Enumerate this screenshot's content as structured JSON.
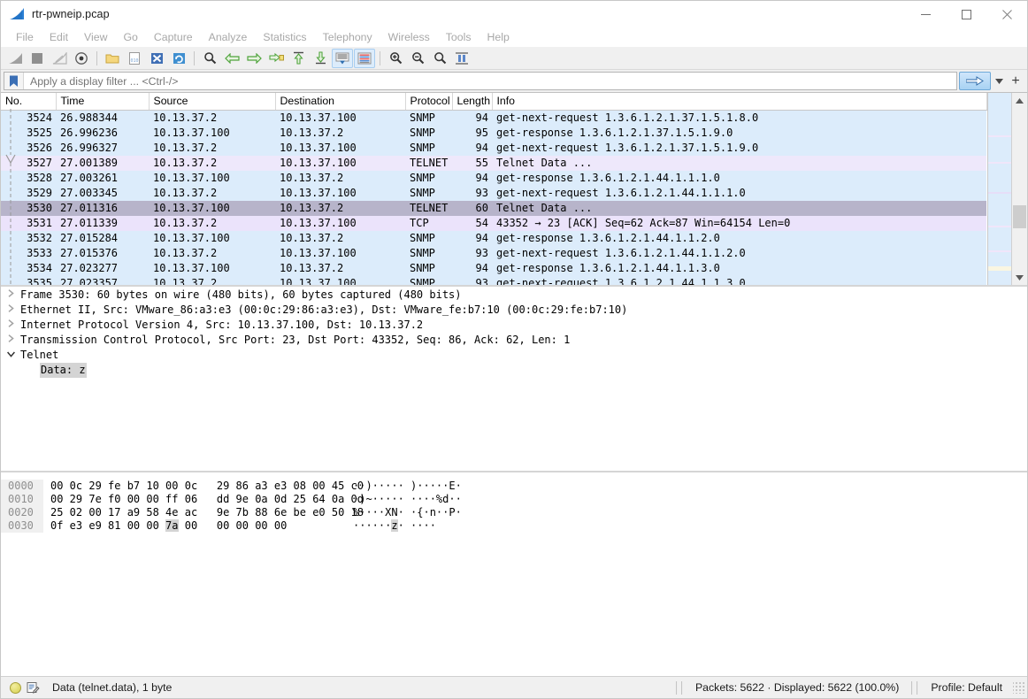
{
  "window": {
    "title": "rtr-pwneip.pcap",
    "logo_icon": "wireshark-fin-icon",
    "minimize_label": "—",
    "maximize_label": "☐",
    "close_label": "✕"
  },
  "menu": {
    "items": [
      {
        "label": "File"
      },
      {
        "label": "Edit"
      },
      {
        "label": "View"
      },
      {
        "label": "Go"
      },
      {
        "label": "Capture"
      },
      {
        "label": "Analyze"
      },
      {
        "label": "Statistics"
      },
      {
        "label": "Telephony"
      },
      {
        "label": "Wireless"
      },
      {
        "label": "Tools"
      },
      {
        "label": "Help"
      }
    ]
  },
  "toolbar": {
    "buttons": [
      {
        "name": "start-capture-icon",
        "title": "Start capturing packets"
      },
      {
        "name": "stop-capture-icon",
        "title": "Stop capturing packets"
      },
      {
        "name": "restart-capture-icon",
        "title": "Restart current capture"
      },
      {
        "name": "capture-options-icon",
        "title": "Capture options"
      },
      {
        "name": "open-file-icon",
        "title": "Open capture file"
      },
      {
        "name": "save-file-icon",
        "title": "Save this capture file"
      },
      {
        "name": "close-file-icon",
        "title": "Close this capture file"
      },
      {
        "name": "reload-file-icon",
        "title": "Reload this file"
      },
      {
        "name": "find-packet-icon",
        "title": "Find a packet"
      },
      {
        "name": "go-back-icon",
        "title": "Go back in packet history"
      },
      {
        "name": "go-forward-icon",
        "title": "Go forward in packet history"
      },
      {
        "name": "go-to-packet-icon",
        "title": "Go to the packet with number"
      },
      {
        "name": "go-first-packet-icon",
        "title": "Go to the first packet"
      },
      {
        "name": "go-last-packet-icon",
        "title": "Go to the last packet"
      },
      {
        "name": "auto-scroll-icon",
        "title": "Auto scroll in live capture"
      },
      {
        "name": "colorize-icon",
        "title": "Colorize packet list"
      },
      {
        "name": "zoom-in-icon",
        "title": "Zoom in"
      },
      {
        "name": "zoom-out-icon",
        "title": "Zoom out"
      },
      {
        "name": "zoom-reset-icon",
        "title": "Normal size"
      },
      {
        "name": "resize-columns-icon",
        "title": "Resize columns"
      }
    ]
  },
  "filter": {
    "bookmark_icon": "bookmark-icon",
    "placeholder": "Apply a display filter ... <Ctrl-/>",
    "value": "",
    "apply_icon": "arrow-right-icon",
    "dropdown_icon": "chevron-down-icon",
    "add_icon": "plus-icon"
  },
  "packet_list": {
    "columns": [
      "No.",
      "Time",
      "Source",
      "Destination",
      "Protocol",
      "Length",
      "Info"
    ],
    "rows": [
      {
        "no": "3524",
        "time": "26.988344",
        "src": "10.13.37.2",
        "dst": "10.13.37.100",
        "proto": "SNMP",
        "len": "94",
        "info": "get-next-request 1.3.6.1.2.1.37.1.5.1.8.0",
        "style": "r-snmp"
      },
      {
        "no": "3525",
        "time": "26.996236",
        "src": "10.13.37.100",
        "dst": "10.13.37.2",
        "proto": "SNMP",
        "len": "95",
        "info": "get-response 1.3.6.1.2.1.37.1.5.1.9.0",
        "style": "r-snmp"
      },
      {
        "no": "3526",
        "time": "26.996327",
        "src": "10.13.37.2",
        "dst": "10.13.37.100",
        "proto": "SNMP",
        "len": "94",
        "info": "get-next-request 1.3.6.1.2.1.37.1.5.1.9.0",
        "style": "r-snmp"
      },
      {
        "no": "3527",
        "time": "27.001389",
        "src": "10.13.37.2",
        "dst": "10.13.37.100",
        "proto": "TELNET",
        "len": "55",
        "info": "Telnet Data ...",
        "style": "r-telnet"
      },
      {
        "no": "3528",
        "time": "27.003261",
        "src": "10.13.37.100",
        "dst": "10.13.37.2",
        "proto": "SNMP",
        "len": "94",
        "info": "get-response 1.3.6.1.2.1.44.1.1.1.0",
        "style": "r-snmp"
      },
      {
        "no": "3529",
        "time": "27.003345",
        "src": "10.13.37.2",
        "dst": "10.13.37.100",
        "proto": "SNMP",
        "len": "93",
        "info": "get-next-request 1.3.6.1.2.1.44.1.1.1.0",
        "style": "r-snmp"
      },
      {
        "no": "3530",
        "time": "27.011316",
        "src": "10.13.37.100",
        "dst": "10.13.37.2",
        "proto": "TELNET",
        "len": "60",
        "info": "Telnet Data ...",
        "style": "r-sel"
      },
      {
        "no": "3531",
        "time": "27.011339",
        "src": "10.13.37.2",
        "dst": "10.13.37.100",
        "proto": "TCP",
        "len": "54",
        "info": "43352 → 23 [ACK] Seq=62 Ack=87 Win=64154 Len=0",
        "style": "r-tcp"
      },
      {
        "no": "3532",
        "time": "27.015284",
        "src": "10.13.37.100",
        "dst": "10.13.37.2",
        "proto": "SNMP",
        "len": "94",
        "info": "get-response 1.3.6.1.2.1.44.1.1.2.0",
        "style": "r-snmp"
      },
      {
        "no": "3533",
        "time": "27.015376",
        "src": "10.13.37.2",
        "dst": "10.13.37.100",
        "proto": "SNMP",
        "len": "93",
        "info": "get-next-request 1.3.6.1.2.1.44.1.1.2.0",
        "style": "r-snmp"
      },
      {
        "no": "3534",
        "time": "27.023277",
        "src": "10.13.37.100",
        "dst": "10.13.37.2",
        "proto": "SNMP",
        "len": "94",
        "info": "get-response 1.3.6.1.2.1.44.1.1.3.0",
        "style": "r-snmp"
      },
      {
        "no": "3535",
        "time": "27.023357",
        "src": "10.13.37.2",
        "dst": "10.13.37.100",
        "proto": "SNMP",
        "len": "93",
        "info": "get-next-request 1.3.6.1.2.1.44.1.1.3.0",
        "style": "r-snmp"
      }
    ],
    "selected_no": "3530"
  },
  "detail": {
    "rows": [
      {
        "expanded": false,
        "text": "Frame 3530: 60 bytes on wire (480 bits), 60 bytes captured (480 bits)"
      },
      {
        "expanded": false,
        "text": "Ethernet II, Src: VMware_86:a3:e3 (00:0c:29:86:a3:e3), Dst: VMware_fe:b7:10 (00:0c:29:fe:b7:10)"
      },
      {
        "expanded": false,
        "text": "Internet Protocol Version 4, Src: 10.13.37.100, Dst: 10.13.37.2"
      },
      {
        "expanded": false,
        "text": "Transmission Control Protocol, Src Port: 23, Dst Port: 43352, Seq: 86, Ack: 62, Len: 1"
      },
      {
        "expanded": true,
        "text": "Telnet"
      }
    ],
    "child_row": "Data: z"
  },
  "hexdump": {
    "rows": [
      {
        "offset": "0000",
        "bytes": "00 0c 29 fe b7 10 00 0c   29 86 a3 e3 08 00 45 c0",
        "ascii": "··)····· )·····E·"
      },
      {
        "offset": "0010",
        "bytes": "00 29 7e f0 00 00 ff 06   dd 9e 0a 0d 25 64 0a 0d",
        "ascii": "·)~····· ····%d··"
      },
      {
        "offset": "0020",
        "bytes": "25 02 00 17 a9 58 4e ac   9e 7b 88 6e be e0 50 18",
        "ascii": "%····XN· ·{·n··P·"
      },
      {
        "offset": "0030",
        "bytes": "0f e3 e9 81 00 00 7a 00   00 00 00 00",
        "ascii": "······z· ····"
      }
    ],
    "highlight_byte": "7a",
    "highlight_ascii": "z"
  },
  "statusbar": {
    "expert_icon": "expert-info-icon",
    "capture_file_icon": "capture-comment-icon",
    "field_text": "Data (telnet.data), 1 byte",
    "packets_text": "Packets: 5622 · Displayed: 5622 (100.0%)",
    "profile_text": "Profile: Default"
  },
  "colors": {
    "snmp_row": "#dcecfb",
    "telnet_row": "#eee8fb",
    "tcp_row": "#ebe3fb",
    "selected_row": "#b7b4ca",
    "accent": "#2d7dd2"
  }
}
